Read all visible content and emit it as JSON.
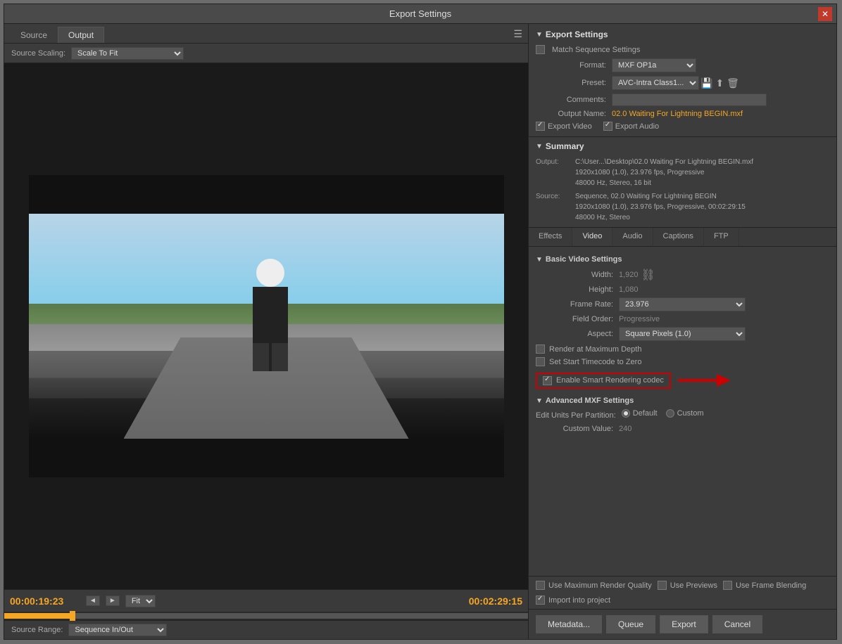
{
  "dialog": {
    "title": "Export Settings",
    "close_btn": "✕"
  },
  "left_panel": {
    "tabs": [
      {
        "label": "Source",
        "active": false
      },
      {
        "label": "Output",
        "active": true
      }
    ],
    "source_scaling": {
      "label": "Source Scaling:",
      "value": "Scale To Fit"
    },
    "timecode_start": "00:00:19:23",
    "timecode_end": "00:02:29:15",
    "fit_label": "Fit",
    "source_range_label": "Source Range:",
    "source_range_value": "Sequence In/Out"
  },
  "right_panel": {
    "export_settings": {
      "title": "Export Settings",
      "match_seq_label": "Match Sequence Settings",
      "format_label": "Format:",
      "format_value": "MXF OP1a",
      "preset_label": "Preset:",
      "preset_value": "AVC-Intra Class1...",
      "comments_label": "Comments:",
      "output_name_label": "Output Name:",
      "output_name_value": "02.0 Waiting For Lightning BEGIN.mxf",
      "export_video_label": "Export Video",
      "export_audio_label": "Export Audio"
    },
    "summary": {
      "title": "Summary",
      "output_label": "Output:",
      "output_value": "C:\\User...\\Desktop\\02.0 Waiting For Lightning BEGIN.mxf",
      "output_detail1": "1920x1080 (1.0), 23.976 fps, Progressive",
      "output_detail2": "48000 Hz, Stereo, 16 bit",
      "source_label": "Source:",
      "source_value": "Sequence, 02.0 Waiting For Lightning BEGIN",
      "source_detail1": "1920x1080 (1.0), 23.976 fps, Progressive, 00:02:29:15",
      "source_detail2": "48000 Hz, Stereo"
    },
    "tabs": [
      "Effects",
      "Video",
      "Audio",
      "Captions",
      "FTP"
    ],
    "active_tab": "Video",
    "basic_video": {
      "title": "Basic Video Settings",
      "width_label": "Width:",
      "width_value": "1,920",
      "height_label": "Height:",
      "height_value": "1,080",
      "frame_rate_label": "Frame Rate:",
      "frame_rate_value": "23.976",
      "field_order_label": "Field Order:",
      "field_order_value": "Progressive",
      "aspect_label": "Aspect:",
      "aspect_value": "Square Pixels (1.0)",
      "render_max_depth": "Render at Maximum Depth",
      "set_start_timecode": "Set Start Timecode to Zero",
      "smart_render_label": "Enable Smart Rendering codec"
    },
    "advanced_mxf": {
      "title": "Advanced MXF Settings",
      "edit_units_label": "Edit Units Per Partition:",
      "default_label": "Default",
      "custom_label": "Custom",
      "custom_value_label": "Custom Value:",
      "custom_value": "240"
    },
    "bottom_checks": [
      {
        "label": "Use Maximum Render Quality",
        "checked": false
      },
      {
        "label": "Use Previews",
        "checked": false
      },
      {
        "label": "Use Frame Blending",
        "checked": false
      },
      {
        "label": "Import into project",
        "checked": true
      }
    ],
    "buttons": {
      "metadata": "Metadata...",
      "queue": "Queue",
      "export": "Export",
      "cancel": "Cancel"
    }
  }
}
